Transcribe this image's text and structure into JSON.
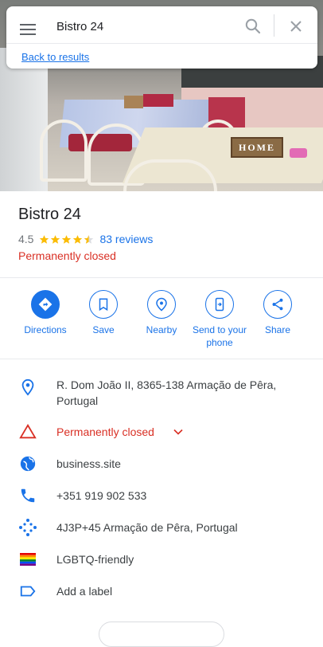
{
  "search": {
    "query": "Bistro 24"
  },
  "back_link": "Back to results",
  "hero": {
    "sign_text": "HOME"
  },
  "place": {
    "name": "Bistro 24",
    "rating": "4.5",
    "rating_value": 4.5,
    "reviews": "83 reviews",
    "status": "Permanently closed"
  },
  "actions": [
    {
      "label": "Directions",
      "icon": "directions-icon"
    },
    {
      "label": "Save",
      "icon": "bookmark-icon"
    },
    {
      "label": "Nearby",
      "icon": "nearby-icon"
    },
    {
      "label": "Send to your phone",
      "icon": "send-to-phone-icon"
    },
    {
      "label": "Share",
      "icon": "share-icon"
    }
  ],
  "info": {
    "address": "R. Dom João II, 8365-138 Armação de Pêra, Portugal",
    "status": "Permanently closed",
    "website": "business.site",
    "phone": "+351 919 902 533",
    "plus_code": "4J3P+45 Armação de Pêra, Portugal",
    "amenity": "LGBTQ-friendly",
    "add_label": "Add a label"
  },
  "colors": {
    "accent": "#1a73e8",
    "closed": "#d93025",
    "star": "#fbbc04"
  }
}
